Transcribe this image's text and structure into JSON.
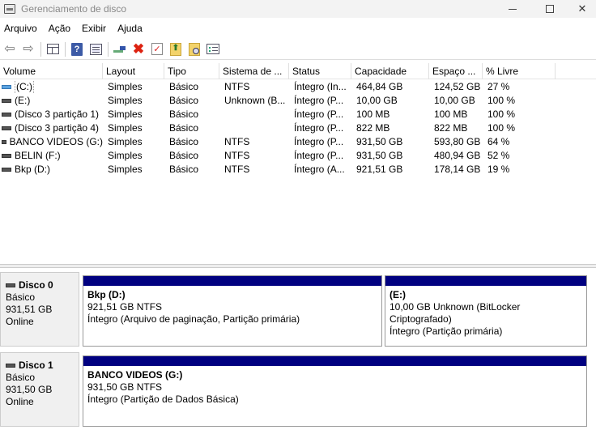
{
  "window": {
    "title": "Gerenciamento de disco",
    "min_glyph": "—",
    "close_glyph": "✕"
  },
  "menu": [
    "Arquivo",
    "Ação",
    "Exibir",
    "Ajuda"
  ],
  "toolbar": {
    "back_glyph": "⇦",
    "forward_glyph": "⇨",
    "help_glyph": "?",
    "delete_glyph": "✖",
    "check_glyph": "✓",
    "up_glyph": "⬆"
  },
  "volume_table": {
    "columns": [
      "Volume",
      "Layout",
      "Tipo",
      "Sistema de ...",
      "Status",
      "Capacidade",
      "Espaço ...",
      "% Livre"
    ],
    "rows": [
      {
        "icon": "system-volume-icon",
        "volume": "(C:)",
        "layout": "Simples",
        "tipo": "Básico",
        "fs": "NTFS",
        "status": "Íntegro (In...",
        "capacidade": "464,84 GB",
        "espaco": "124,52 GB",
        "livre": "27 %"
      },
      {
        "icon": "volume-icon",
        "volume": "(E:)",
        "layout": "Simples",
        "tipo": "Básico",
        "fs": "Unknown (B...",
        "status": "Íntegro (P...",
        "capacidade": "10,00 GB",
        "espaco": "10,00 GB",
        "livre": "100 %"
      },
      {
        "icon": "volume-icon",
        "volume": "(Disco 3 partição 1)",
        "layout": "Simples",
        "tipo": "Básico",
        "fs": "",
        "status": "Íntegro (P...",
        "capacidade": "100 MB",
        "espaco": "100 MB",
        "livre": "100 %"
      },
      {
        "icon": "volume-icon",
        "volume": "(Disco 3 partição 4)",
        "layout": "Simples",
        "tipo": "Básico",
        "fs": "",
        "status": "Íntegro (P...",
        "capacidade": "822 MB",
        "espaco": "822 MB",
        "livre": "100 %"
      },
      {
        "icon": "volume-icon",
        "volume": "BANCO VIDEOS (G:)",
        "layout": "Simples",
        "tipo": "Básico",
        "fs": "NTFS",
        "status": "Íntegro (P...",
        "capacidade": "931,50 GB",
        "espaco": "593,80 GB",
        "livre": "64 %"
      },
      {
        "icon": "volume-icon",
        "volume": "BELIN (F:)",
        "layout": "Simples",
        "tipo": "Básico",
        "fs": "NTFS",
        "status": "Íntegro (P...",
        "capacidade": "931,50 GB",
        "espaco": "480,94 GB",
        "livre": "52 %"
      },
      {
        "icon": "volume-icon",
        "volume": "Bkp (D:)",
        "layout": "Simples",
        "tipo": "Básico",
        "fs": "NTFS",
        "status": "Íntegro (A...",
        "capacidade": "921,51 GB",
        "espaco": "178,14 GB",
        "livre": "19 %"
      }
    ]
  },
  "disks": [
    {
      "name": "Disco 0",
      "type": "Básico",
      "size": "931,51 GB",
      "state": "Online",
      "partitions": [
        {
          "title": "Bkp  (D:)",
          "size_fs": "921,51 GB NTFS",
          "status": "Íntegro (Arquivo de paginação, Partição primária)"
        },
        {
          "title": "(E:)",
          "size_fs": "10,00 GB Unknown (BitLocker Criptografado)",
          "status": "Íntegro (Partição primária)"
        }
      ]
    },
    {
      "name": "Disco 1",
      "type": "Básico",
      "size": "931,50 GB",
      "state": "Online",
      "partitions": [
        {
          "title": "BANCO VIDEOS  (G:)",
          "size_fs": "931,50 GB NTFS",
          "status": "Íntegro (Partição de Dados Básica)"
        }
      ]
    }
  ]
}
